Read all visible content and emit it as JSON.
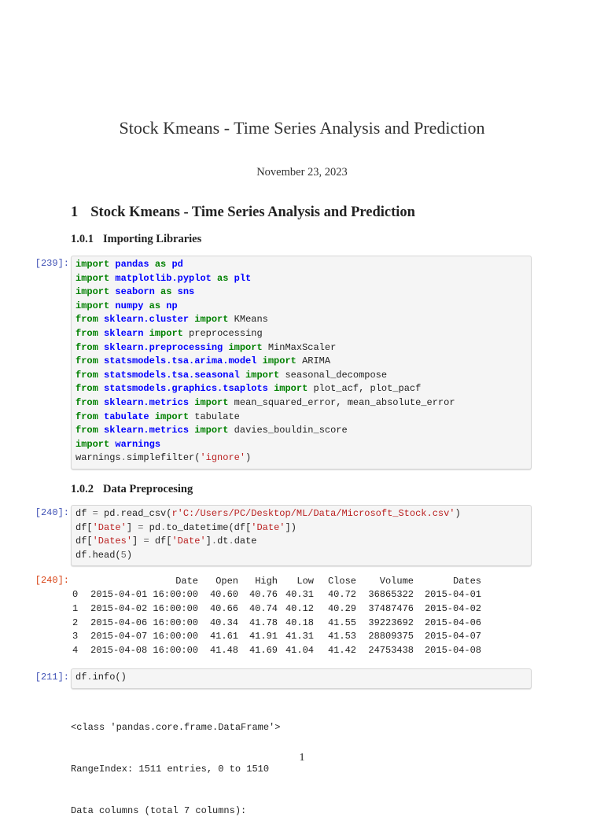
{
  "doc": {
    "title": "Stock Kmeans - Time Series Analysis and Prediction",
    "date": "November 23, 2023",
    "page_number": "1"
  },
  "section": {
    "number": "1",
    "title": "Stock Kmeans - Time Series Analysis and Prediction"
  },
  "subsections": [
    {
      "number": "1.0.1",
      "title": "Importing Libraries"
    },
    {
      "number": "1.0.2",
      "title": "Data Preprocesing"
    }
  ],
  "cells": [
    {
      "prompt": "[239]:",
      "lines": [
        [
          [
            "import",
            "k"
          ],
          [
            " ",
            ""
          ],
          [
            "pandas",
            "n"
          ],
          [
            " ",
            ""
          ],
          [
            "as",
            "k"
          ],
          [
            " ",
            ""
          ],
          [
            "pd",
            "n"
          ]
        ],
        [
          [
            "import",
            "k"
          ],
          [
            " ",
            ""
          ],
          [
            "matplotlib.pyplot",
            "n"
          ],
          [
            " ",
            ""
          ],
          [
            "as",
            "k"
          ],
          [
            " ",
            ""
          ],
          [
            "plt",
            "n"
          ]
        ],
        [
          [
            "import",
            "k"
          ],
          [
            " ",
            ""
          ],
          [
            "seaborn",
            "n"
          ],
          [
            " ",
            ""
          ],
          [
            "as",
            "k"
          ],
          [
            " ",
            ""
          ],
          [
            "sns",
            "n"
          ]
        ],
        [
          [
            "import",
            "k"
          ],
          [
            " ",
            ""
          ],
          [
            "numpy",
            "n"
          ],
          [
            " ",
            ""
          ],
          [
            "as",
            "k"
          ],
          [
            " ",
            ""
          ],
          [
            "np",
            "n"
          ]
        ],
        [
          [
            "from",
            "k"
          ],
          [
            " ",
            ""
          ],
          [
            "sklearn.cluster",
            "n"
          ],
          [
            " ",
            ""
          ],
          [
            "import",
            "k"
          ],
          [
            " KMeans",
            ""
          ]
        ],
        [
          [
            "from",
            "k"
          ],
          [
            " ",
            ""
          ],
          [
            "sklearn",
            "n"
          ],
          [
            " ",
            ""
          ],
          [
            "import",
            "k"
          ],
          [
            " preprocessing",
            ""
          ]
        ],
        [
          [
            "from",
            "k"
          ],
          [
            " ",
            ""
          ],
          [
            "sklearn.preprocessing",
            "n"
          ],
          [
            " ",
            ""
          ],
          [
            "import",
            "k"
          ],
          [
            " MinMaxScaler",
            ""
          ]
        ],
        [
          [
            "from",
            "k"
          ],
          [
            " ",
            ""
          ],
          [
            "statsmodels.tsa.arima.model",
            "n"
          ],
          [
            " ",
            ""
          ],
          [
            "import",
            "k"
          ],
          [
            " ARIMA",
            ""
          ]
        ],
        [
          [
            "from",
            "k"
          ],
          [
            " ",
            ""
          ],
          [
            "statsmodels.tsa.seasonal",
            "n"
          ],
          [
            " ",
            ""
          ],
          [
            "import",
            "k"
          ],
          [
            " seasonal_decompose",
            ""
          ]
        ],
        [
          [
            "from",
            "k"
          ],
          [
            " ",
            ""
          ],
          [
            "statsmodels.graphics.tsaplots",
            "n"
          ],
          [
            " ",
            ""
          ],
          [
            "import",
            "k"
          ],
          [
            " plot_acf, plot_pacf",
            ""
          ]
        ],
        [
          [
            "from",
            "k"
          ],
          [
            " ",
            ""
          ],
          [
            "sklearn.metrics",
            "n"
          ],
          [
            " ",
            ""
          ],
          [
            "import",
            "k"
          ],
          [
            " mean_squared_error, mean_absolute_error",
            ""
          ]
        ],
        [
          [
            "from",
            "k"
          ],
          [
            " ",
            ""
          ],
          [
            "tabulate",
            "n"
          ],
          [
            " ",
            ""
          ],
          [
            "import",
            "k"
          ],
          [
            " tabulate",
            ""
          ]
        ],
        [
          [
            "from",
            "k"
          ],
          [
            " ",
            ""
          ],
          [
            "sklearn.metrics",
            "n"
          ],
          [
            " ",
            ""
          ],
          [
            "import",
            "k"
          ],
          [
            " davies_bouldin_score",
            ""
          ]
        ],
        [
          [
            "import",
            "k"
          ],
          [
            " ",
            ""
          ],
          [
            "warnings",
            "n"
          ]
        ],
        [
          [
            "warnings",
            ""
          ],
          [
            ".",
            "o"
          ],
          [
            "simplefilter(",
            ""
          ],
          [
            "'ignore'",
            "s"
          ],
          [
            ")",
            ""
          ]
        ]
      ]
    },
    {
      "prompt": "[240]:",
      "lines": [
        [
          [
            "df ",
            ""
          ],
          [
            "=",
            "o"
          ],
          [
            " pd",
            ""
          ],
          [
            ".",
            "o"
          ],
          [
            "read_csv(",
            ""
          ],
          [
            "r'C:/Users/PC/Desktop/ML/Data/Microsoft_Stock.csv'",
            "s"
          ],
          [
            ")",
            ""
          ]
        ],
        [
          [
            "df[",
            ""
          ],
          [
            "'Date'",
            "s"
          ],
          [
            "] ",
            ""
          ],
          [
            "=",
            "o"
          ],
          [
            " pd",
            ""
          ],
          [
            ".",
            "o"
          ],
          [
            "to_datetime(df[",
            ""
          ],
          [
            "'Date'",
            "s"
          ],
          [
            "])",
            ""
          ]
        ],
        [
          [
            "df[",
            ""
          ],
          [
            "'Dates'",
            "s"
          ],
          [
            "] ",
            ""
          ],
          [
            "=",
            "o"
          ],
          [
            " df[",
            ""
          ],
          [
            "'Date'",
            "s"
          ],
          [
            "]",
            ""
          ],
          [
            ".",
            "o"
          ],
          [
            "dt",
            ""
          ],
          [
            ".",
            "o"
          ],
          [
            "date",
            ""
          ]
        ],
        [
          [
            "df",
            ""
          ],
          [
            ".",
            "o"
          ],
          [
            "head(",
            ""
          ],
          [
            "5",
            "o"
          ],
          [
            ")",
            ""
          ]
        ]
      ]
    },
    {
      "prompt": "[211]:",
      "lines": [
        [
          [
            "df",
            ""
          ],
          [
            ".",
            "o"
          ],
          [
            "info()",
            ""
          ]
        ]
      ]
    }
  ],
  "head_output": {
    "prompt": "[240]:",
    "columns": [
      "",
      "Date",
      "Open",
      "High",
      "Low",
      "Close",
      "Volume",
      "Dates"
    ],
    "rows": [
      [
        "0",
        "2015-04-01 16:00:00",
        "40.60",
        "40.76",
        "40.31",
        "40.72",
        "36865322",
        "2015-04-01"
      ],
      [
        "1",
        "2015-04-02 16:00:00",
        "40.66",
        "40.74",
        "40.12",
        "40.29",
        "37487476",
        "2015-04-02"
      ],
      [
        "2",
        "2015-04-06 16:00:00",
        "40.34",
        "41.78",
        "40.18",
        "41.55",
        "39223692",
        "2015-04-06"
      ],
      [
        "3",
        "2015-04-07 16:00:00",
        "41.61",
        "41.91",
        "41.31",
        "41.53",
        "28809375",
        "2015-04-07"
      ],
      [
        "4",
        "2015-04-08 16:00:00",
        "41.48",
        "41.69",
        "41.04",
        "41.42",
        "24753438",
        "2015-04-08"
      ]
    ]
  },
  "info_output": [
    "<class 'pandas.core.frame.DataFrame'>",
    "RangeIndex: 1511 entries, 0 to 1510",
    "Data columns (total 7 columns):"
  ]
}
